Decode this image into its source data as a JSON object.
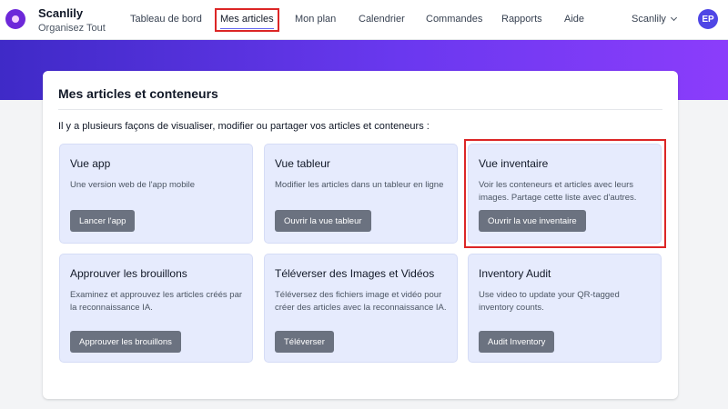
{
  "brand": {
    "name": "Scanlily",
    "tagline": "Organisez Tout"
  },
  "nav": {
    "items": [
      {
        "label": "Tableau de bord"
      },
      {
        "label": "Mes articles"
      },
      {
        "label": "Mon plan"
      },
      {
        "label": "Calendrier"
      },
      {
        "label": "Commandes"
      },
      {
        "label": "Rapports"
      },
      {
        "label": "Aide"
      }
    ],
    "active": "Mes articles"
  },
  "user": {
    "menu_label": "Scanlily",
    "initials": "EP"
  },
  "panel": {
    "title": "Mes articles et conteneurs",
    "intro": "Il y a plusieurs façons de visualiser, modifier ou partager vos articles et conteneurs :"
  },
  "cards": [
    {
      "title": "Vue app",
      "description": "Une version web de l'app mobile",
      "button": "Lancer l'app"
    },
    {
      "title": "Vue tableur",
      "description": "Modifier les articles dans un tableur en ligne",
      "button": "Ouvrir la vue tableur"
    },
    {
      "title": "Vue inventaire",
      "description": "Voir les conteneurs et articles avec leurs images. Partage cette liste avec d'autres.",
      "button": "Ouvrir la vue inventaire"
    },
    {
      "title": "Approuver les brouillons",
      "description": "Examinez et approuvez les articles créés par la reconnaissance IA.",
      "button": "Approuver les brouillons"
    },
    {
      "title": "Téléverser des Images et Vidéos",
      "description": "Téléversez des fichiers image et vidéo pour créer des articles avec la reconnaissance IA.",
      "button": "Téléverser"
    },
    {
      "title": "Inventory Audit",
      "description": "Use video to update your QR-tagged inventory counts.",
      "button": "Audit Inventory"
    }
  ],
  "colors": {
    "accent": "#6366f1",
    "highlight": "#dc2626",
    "card_bg": "#e6ebfd",
    "button_bg": "#6b7280"
  }
}
